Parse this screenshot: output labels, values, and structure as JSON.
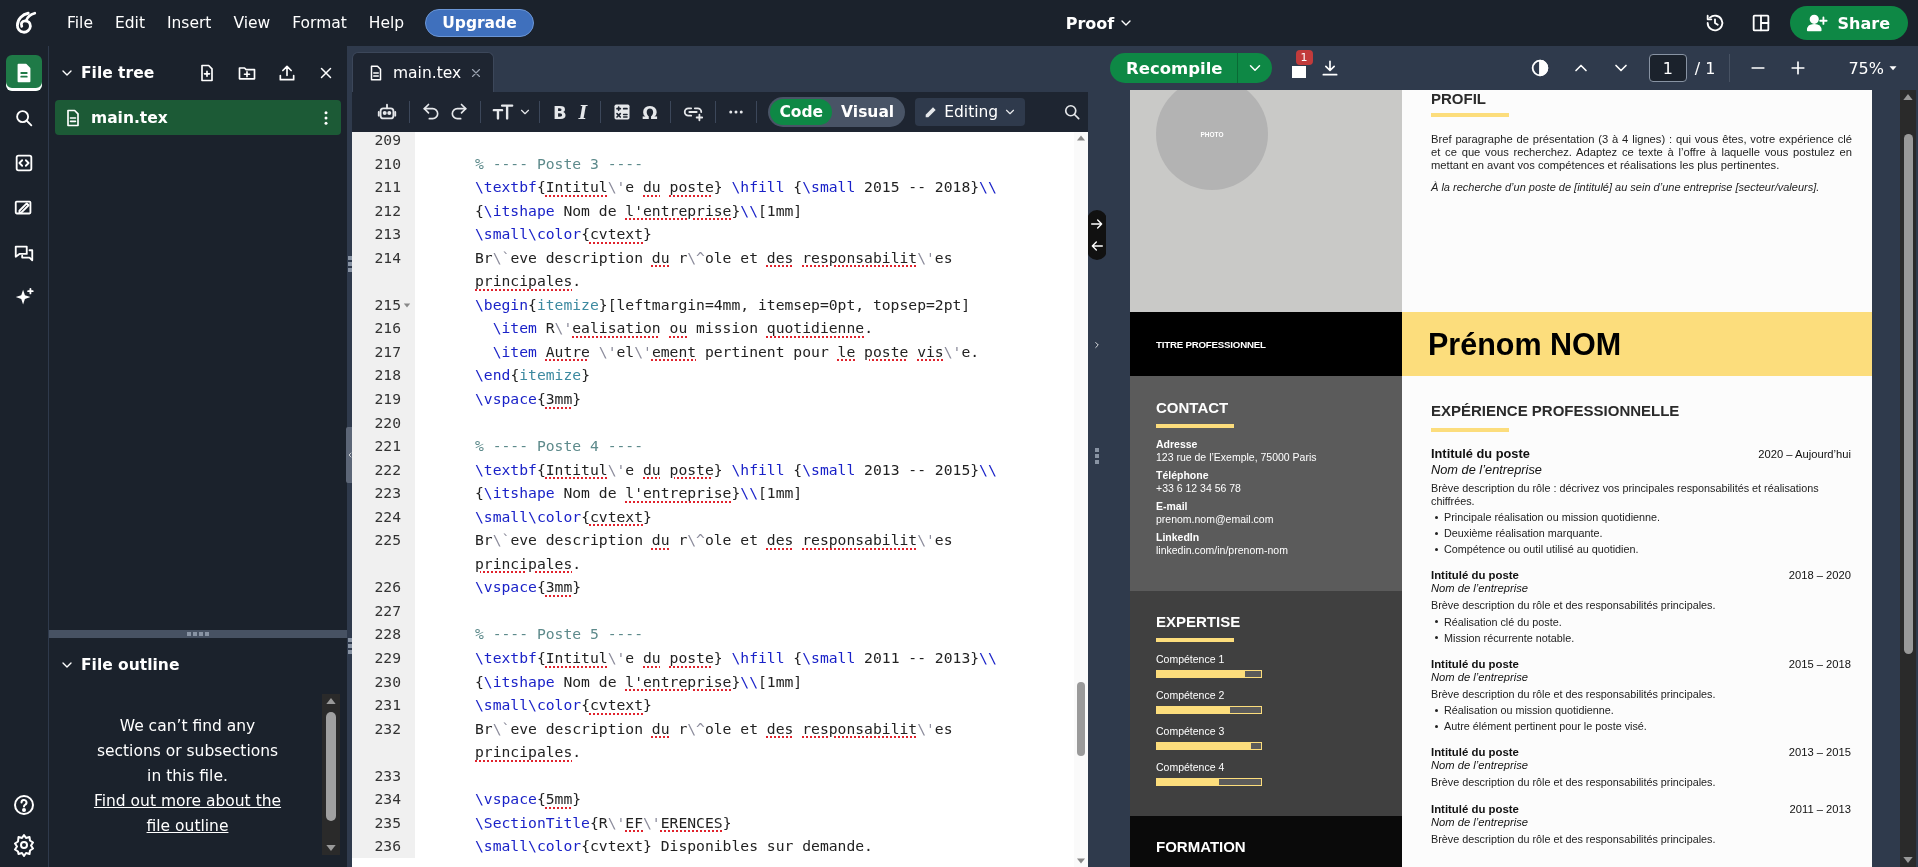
{
  "menu_bar": {
    "menus": [
      "File",
      "Edit",
      "Insert",
      "View",
      "Format",
      "Help"
    ],
    "upgrade": "Upgrade",
    "project_title": "Proof",
    "share": "Share"
  },
  "rail": {
    "items": [
      {
        "kind": "files",
        "selected": true
      },
      {
        "kind": "search",
        "selected": false
      },
      {
        "kind": "code",
        "selected": false
      },
      {
        "kind": "review",
        "selected": false
      },
      {
        "kind": "chat",
        "selected": false
      },
      {
        "kind": "assist",
        "selected": false
      }
    ],
    "bottom": [
      {
        "kind": "help"
      },
      {
        "kind": "settings"
      }
    ]
  },
  "file_tree": {
    "title": "File tree",
    "files": [
      {
        "name": "main.tex",
        "selected": true
      }
    ]
  },
  "file_outline": {
    "title": "File outline",
    "message": "We can’t find any sections or subsections in this file.",
    "link": "Find out more about the file outline"
  },
  "editor": {
    "tabs": [
      {
        "label": "main.tex",
        "selected": true
      }
    ],
    "toolbar": {
      "glyphs": [
        "B",
        "I",
        "Ω"
      ],
      "modes": [
        {
          "label": "Code",
          "selected": true
        },
        {
          "label": "Visual",
          "selected": false
        }
      ],
      "editing": "Editing"
    },
    "lines": [
      {
        "number": "209",
        "foldable": false
      },
      {
        "number": "210",
        "foldable": false,
        "segments": [
          {
            "kind": "comment",
            "text": "% ---- Poste 3 ----"
          }
        ]
      },
      {
        "number": "211",
        "foldable": false,
        "segments": [
          {
            "kind": "cmd",
            "text": "\\textbf"
          },
          {
            "kind": "text",
            "text": "{"
          },
          {
            "kind": "typo",
            "text": "Intitul"
          },
          {
            "kind": "escape",
            "text": "\\'"
          },
          {
            "kind": "text",
            "text": "e "
          },
          {
            "kind": "typo",
            "text": "du "
          },
          {
            "kind": "typo",
            "text": "poste"
          },
          {
            "kind": "text",
            "text": "} "
          },
          {
            "kind": "cmd",
            "text": "\\hfill"
          },
          {
            "kind": "text",
            "text": " {"
          },
          {
            "kind": "cmd",
            "text": "\\small"
          },
          {
            "kind": "text",
            "text": " 2015 -- 2018}"
          },
          {
            "kind": "cmd",
            "text": "\\\\"
          }
        ]
      },
      {
        "number": "212",
        "foldable": false,
        "segments": [
          {
            "kind": "text",
            "text": "{"
          },
          {
            "kind": "cmd",
            "text": "\\itshape"
          },
          {
            "kind": "text",
            "text": " Nom de "
          },
          {
            "kind": "typo",
            "text": "l'entreprise"
          },
          {
            "kind": "text",
            "text": "}"
          },
          {
            "kind": "cmd",
            "text": "\\\\"
          },
          {
            "kind": "text",
            "text": "[1mm]"
          }
        ]
      },
      {
        "number": "213",
        "foldable": false,
        "segments": [
          {
            "kind": "cmd",
            "text": "\\small\\color"
          },
          {
            "kind": "text",
            "text": "{"
          },
          {
            "kind": "typo",
            "text": "cvtext"
          },
          {
            "kind": "text",
            "text": "}"
          }
        ]
      },
      {
        "number": "214",
        "foldable": false,
        "segments": [
          {
            "kind": "text",
            "text": "Br"
          },
          {
            "kind": "escape",
            "text": "\\`"
          },
          {
            "kind": "text",
            "text": "eve description "
          },
          {
            "kind": "typo",
            "text": "du"
          },
          {
            "kind": "text",
            "text": " r"
          },
          {
            "kind": "escape",
            "text": "\\^"
          },
          {
            "kind": "text",
            "text": "ole et "
          },
          {
            "kind": "typo",
            "text": "des "
          },
          {
            "kind": "typo",
            "text": "responsabilit"
          },
          {
            "kind": "escape",
            "text": "\\'"
          },
          {
            "kind": "text",
            "text": "es "
          },
          {
            "kind": "typo",
            "text": "principales"
          },
          {
            "kind": "text",
            "text": "."
          }
        ]
      },
      {
        "number": "215",
        "foldable": true,
        "segments": [
          {
            "kind": "cmd",
            "text": "\\begin"
          },
          {
            "kind": "text",
            "text": "{"
          },
          {
            "kind": "env",
            "text": "itemize"
          },
          {
            "kind": "text",
            "text": "}[leftmargin=4mm, itemsep=0pt, topsep=2pt]"
          }
        ]
      },
      {
        "number": "216",
        "foldable": false,
        "segments": [
          {
            "kind": "cmd",
            "text": "  \\item"
          },
          {
            "kind": "text",
            "text": " R"
          },
          {
            "kind": "escape",
            "text": "\\'"
          },
          {
            "kind": "typo",
            "text": "ealisation "
          },
          {
            "kind": "typo",
            "text": "ou"
          },
          {
            "kind": "text",
            "text": " mission "
          },
          {
            "kind": "typo",
            "text": "quotidienne"
          },
          {
            "kind": "text",
            "text": "."
          }
        ]
      },
      {
        "number": "217",
        "foldable": false,
        "segments": [
          {
            "kind": "cmd",
            "text": "  \\item "
          },
          {
            "kind": "typo",
            "text": "Autre "
          },
          {
            "kind": "escape",
            "text": "\\'"
          },
          {
            "kind": "text",
            "text": "el"
          },
          {
            "kind": "escape",
            "text": "\\'"
          },
          {
            "kind": "typo",
            "text": "ement"
          },
          {
            "kind": "text",
            "text": " pertinent pour "
          },
          {
            "kind": "typo",
            "text": "le "
          },
          {
            "kind": "typo",
            "text": "poste "
          },
          {
            "kind": "typo",
            "text": "vis"
          },
          {
            "kind": "escape",
            "text": "\\'"
          },
          {
            "kind": "text",
            "text": "e."
          }
        ]
      },
      {
        "number": "218",
        "foldable": false,
        "segments": [
          {
            "kind": "cmd",
            "text": "\\end"
          },
          {
            "kind": "text",
            "text": "{"
          },
          {
            "kind": "env",
            "text": "itemize"
          },
          {
            "kind": "text",
            "text": "}"
          }
        ]
      },
      {
        "number": "219",
        "foldable": false,
        "segments": [
          {
            "kind": "cmd",
            "text": "\\vspace"
          },
          {
            "kind": "text",
            "text": "{"
          },
          {
            "kind": "typo",
            "text": "3mm"
          },
          {
            "kind": "text",
            "text": "}"
          }
        ]
      },
      {
        "number": "220",
        "foldable": false
      },
      {
        "number": "221",
        "foldable": false,
        "segments": [
          {
            "kind": "comment",
            "text": "% ---- Poste 4 ----"
          }
        ]
      },
      {
        "number": "222",
        "foldable": false,
        "segments": [
          {
            "kind": "cmd",
            "text": "\\textbf"
          },
          {
            "kind": "text",
            "text": "{"
          },
          {
            "kind": "typo",
            "text": "Intitul"
          },
          {
            "kind": "escape",
            "text": "\\'"
          },
          {
            "kind": "text",
            "text": "e "
          },
          {
            "kind": "typo",
            "text": "du "
          },
          {
            "kind": "typo",
            "text": "poste"
          },
          {
            "kind": "text",
            "text": "} "
          },
          {
            "kind": "cmd",
            "text": "\\hfill"
          },
          {
            "kind": "text",
            "text": " {"
          },
          {
            "kind": "cmd",
            "text": "\\small"
          },
          {
            "kind": "text",
            "text": " 2013 -- 2015}"
          },
          {
            "kind": "cmd",
            "text": "\\\\"
          }
        ]
      },
      {
        "number": "223",
        "foldable": false,
        "segments": [
          {
            "kind": "text",
            "text": "{"
          },
          {
            "kind": "cmd",
            "text": "\\itshape"
          },
          {
            "kind": "text",
            "text": " Nom de "
          },
          {
            "kind": "typo",
            "text": "l'entreprise"
          },
          {
            "kind": "text",
            "text": "}"
          },
          {
            "kind": "cmd",
            "text": "\\\\"
          },
          {
            "kind": "text",
            "text": "[1mm]"
          }
        ]
      },
      {
        "number": "224",
        "foldable": false,
        "segments": [
          {
            "kind": "cmd",
            "text": "\\small\\color"
          },
          {
            "kind": "text",
            "text": "{"
          },
          {
            "kind": "typo",
            "text": "cvtext"
          },
          {
            "kind": "text",
            "text": "}"
          }
        ]
      },
      {
        "number": "225",
        "foldable": false,
        "segments": [
          {
            "kind": "text",
            "text": "Br"
          },
          {
            "kind": "escape",
            "text": "\\`"
          },
          {
            "kind": "text",
            "text": "eve description "
          },
          {
            "kind": "typo",
            "text": "du"
          },
          {
            "kind": "text",
            "text": " r"
          },
          {
            "kind": "escape",
            "text": "\\^"
          },
          {
            "kind": "text",
            "text": "ole et "
          },
          {
            "kind": "typo",
            "text": "des "
          },
          {
            "kind": "typo",
            "text": "responsabilit"
          },
          {
            "kind": "escape",
            "text": "\\'"
          },
          {
            "kind": "text",
            "text": "es "
          },
          {
            "kind": "typo",
            "text": "principales"
          },
          {
            "kind": "text",
            "text": "."
          }
        ]
      },
      {
        "number": "226",
        "foldable": false,
        "segments": [
          {
            "kind": "cmd",
            "text": "\\vspace"
          },
          {
            "kind": "text",
            "text": "{"
          },
          {
            "kind": "typo",
            "text": "3mm"
          },
          {
            "kind": "text",
            "text": "}"
          }
        ]
      },
      {
        "number": "227",
        "foldable": false
      },
      {
        "number": "228",
        "foldable": false,
        "segments": [
          {
            "kind": "comment",
            "text": "% ---- Poste 5 ----"
          }
        ]
      },
      {
        "number": "229",
        "foldable": false,
        "segments": [
          {
            "kind": "cmd",
            "text": "\\textbf"
          },
          {
            "kind": "text",
            "text": "{"
          },
          {
            "kind": "typo",
            "text": "Intitul"
          },
          {
            "kind": "escape",
            "text": "\\'"
          },
          {
            "kind": "text",
            "text": "e "
          },
          {
            "kind": "typo",
            "text": "du "
          },
          {
            "kind": "typo",
            "text": "poste"
          },
          {
            "kind": "text",
            "text": "} "
          },
          {
            "kind": "cmd",
            "text": "\\hfill"
          },
          {
            "kind": "text",
            "text": " {"
          },
          {
            "kind": "cmd",
            "text": "\\small"
          },
          {
            "kind": "text",
            "text": " 2011 -- 2013}"
          },
          {
            "kind": "cmd",
            "text": "\\\\"
          }
        ]
      },
      {
        "number": "230",
        "foldable": false,
        "segments": [
          {
            "kind": "text",
            "text": "{"
          },
          {
            "kind": "cmd",
            "text": "\\itshape"
          },
          {
            "kind": "text",
            "text": " Nom de "
          },
          {
            "kind": "typo",
            "text": "l'entreprise"
          },
          {
            "kind": "text",
            "text": "}"
          },
          {
            "kind": "cmd",
            "text": "\\\\"
          },
          {
            "kind": "text",
            "text": "[1mm]"
          }
        ]
      },
      {
        "number": "231",
        "foldable": false,
        "segments": [
          {
            "kind": "cmd",
            "text": "\\small\\color"
          },
          {
            "kind": "text",
            "text": "{"
          },
          {
            "kind": "typo",
            "text": "cvtext"
          },
          {
            "kind": "text",
            "text": "}"
          }
        ]
      },
      {
        "number": "232",
        "foldable": false,
        "segments": [
          {
            "kind": "text",
            "text": "Br"
          },
          {
            "kind": "escape",
            "text": "\\`"
          },
          {
            "kind": "text",
            "text": "eve description "
          },
          {
            "kind": "typo",
            "text": "du"
          },
          {
            "kind": "text",
            "text": " r"
          },
          {
            "kind": "escape",
            "text": "\\^"
          },
          {
            "kind": "text",
            "text": "ole et "
          },
          {
            "kind": "typo",
            "text": "des "
          },
          {
            "kind": "typo",
            "text": "responsabilit"
          },
          {
            "kind": "escape",
            "text": "\\'"
          },
          {
            "kind": "text",
            "text": "es "
          },
          {
            "kind": "typo",
            "text": "principales"
          },
          {
            "kind": "text",
            "text": "."
          }
        ]
      },
      {
        "number": "233",
        "foldable": false
      },
      {
        "number": "234",
        "foldable": false,
        "segments": [
          {
            "kind": "cmd",
            "text": "\\vspace"
          },
          {
            "kind": "text",
            "text": "{"
          },
          {
            "kind": "typo",
            "text": "5mm"
          },
          {
            "kind": "text",
            "text": "}"
          }
        ]
      },
      {
        "number": "235",
        "foldable": false,
        "segments": [
          {
            "kind": "cmd",
            "text": "\\SectionTitle"
          },
          {
            "kind": "text",
            "text": "{R"
          },
          {
            "kind": "escape",
            "text": "\\'"
          },
          {
            "kind": "typo",
            "text": "EF"
          },
          {
            "kind": "escape",
            "text": "\\'"
          },
          {
            "kind": "typo",
            "text": "ERENCES"
          },
          {
            "kind": "text",
            "text": "}"
          }
        ]
      },
      {
        "number": "236",
        "foldable": false,
        "segments": [
          {
            "kind": "cmd",
            "text": "\\small\\color"
          },
          {
            "kind": "text",
            "text": "{cvtext} Disponibles sur demande."
          }
        ]
      }
    ]
  },
  "pdf": {
    "recompile": "Recompile",
    "log_count": "1",
    "page": "1",
    "page_total": "/ 1",
    "zoom": "75%",
    "document": {
      "photo_label": "PHOTO",
      "job_title": "TITRE PROFESSIONNEL",
      "name": "Prénom NOM",
      "profile": {
        "heading": "PROFIL",
        "paragraph": "Bref paragraphe de présentation (3 à 4 lignes) : qui vous êtes, votre expérience clé et ce que vous recherchez. Adaptez ce texte à l’offre à laquelle vous postulez en mettant en avant vos compétences et réalisations les plus pertinentes.",
        "tagline": "À la recherche d’un poste de [intitulé] au sein d’une entreprise [secteur/valeurs]."
      },
      "contact": {
        "heading": "CONTACT",
        "items": [
          {
            "label": "Adresse",
            "value": "123 rue de l’Exemple, 75000 Paris"
          },
          {
            "label": "Téléphone",
            "value": "+33 6 12 34 56 78"
          },
          {
            "label": "E-mail",
            "value": "prenom.nom@email.com"
          },
          {
            "label": "LinkedIn",
            "value": "linkedin.com/in/prenom-nom"
          }
        ]
      },
      "expertise": {
        "heading": "EXPERTISE",
        "skills": [
          {
            "name": "Compétence 1",
            "level": 0.85
          },
          {
            "name": "Compétence 2",
            "level": 0.7
          },
          {
            "name": "Compétence 3",
            "level": 0.9
          },
          {
            "name": "Compétence 4",
            "level": 0.6
          }
        ]
      },
      "formation": {
        "heading": "FORMATION"
      },
      "experience": {
        "heading": "EXPÉRIENCE PROFESSIONNELLE",
        "jobs": [
          {
            "featured": true,
            "title": "Intitulé du poste",
            "dates": "2020 – Aujourd’hui",
            "company": "Nom de l’entreprise",
            "description": "Brève description du rôle : décrivez vos principales responsabilités et réalisations chiffrées.",
            "bullets": [
              "Principale réalisation ou mission quotidienne.",
              "Deuxième réalisation marquante.",
              "Compétence ou outil utilisé au quotidien."
            ]
          },
          {
            "featured": false,
            "title": "Intitulé du poste",
            "dates": "2018 – 2020",
            "company": "Nom de l’entreprise",
            "description": "Brève description du rôle et des responsabilités principales.",
            "bullets": [
              "Réalisation clé du poste.",
              "Mission récurrente notable."
            ]
          },
          {
            "featured": false,
            "title": "Intitulé du poste",
            "dates": "2015 – 2018",
            "company": "Nom de l’entreprise",
            "description": "Brève description du rôle et des responsabilités principales.",
            "bullets": [
              "Réalisation ou mission quotidienne.",
              "Autre élément pertinent pour le poste visé."
            ]
          },
          {
            "featured": false,
            "title": "Intitulé du poste",
            "dates": "2013 – 2015",
            "company": "Nom de l’entreprise",
            "description": "Brève description du rôle et des responsabilités principales."
          },
          {
            "featured": false,
            "title": "Intitulé du poste",
            "dates": "2011 – 2013",
            "company": "Nom de l’entreprise",
            "description": "Brève description du rôle et des responsabilités principales."
          }
        ]
      }
    }
  }
}
